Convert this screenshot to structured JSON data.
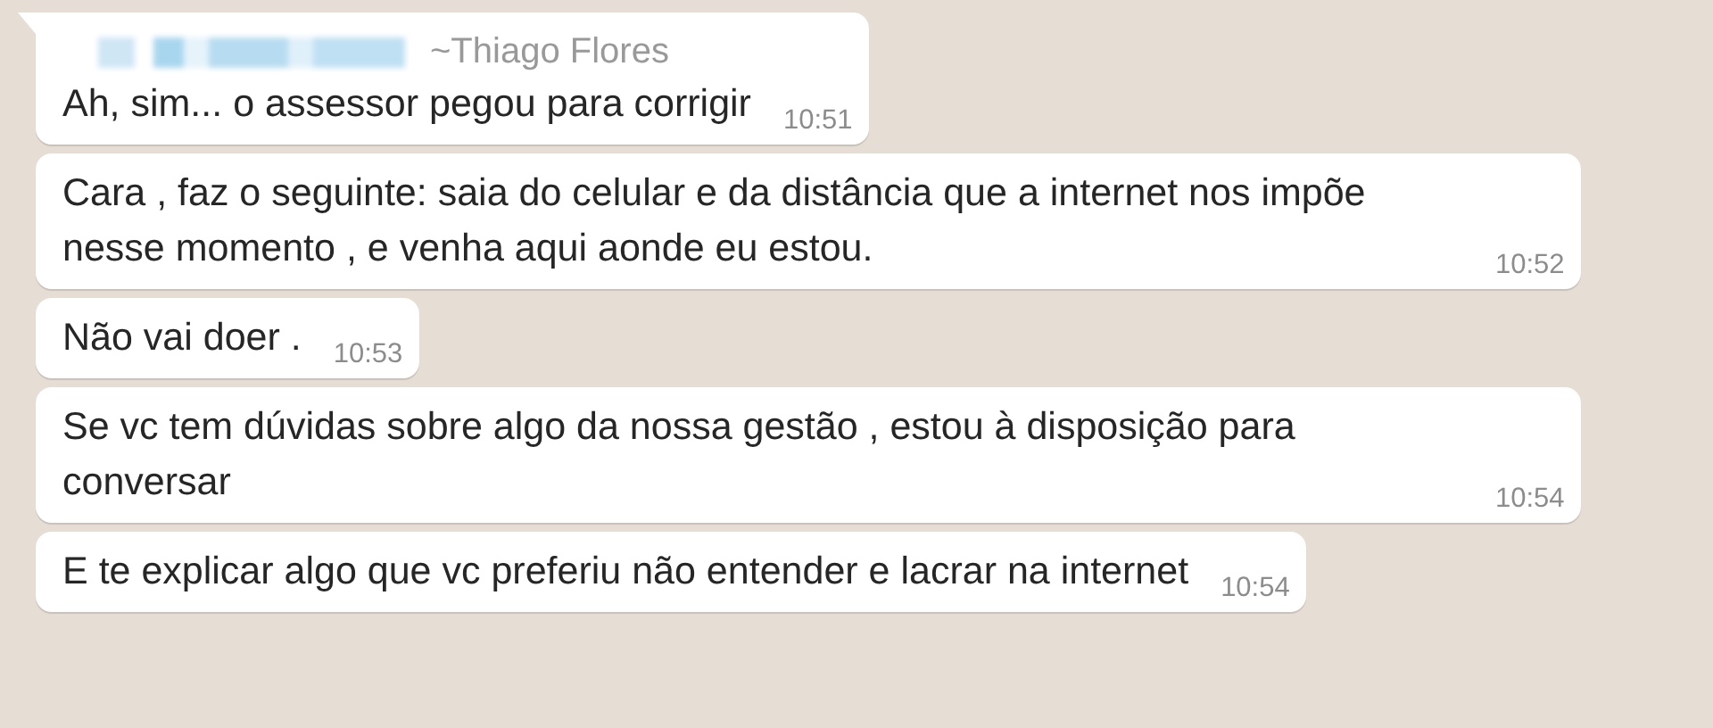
{
  "messages": [
    {
      "sender": {
        "number_redacted": true,
        "name": "~Thiago Flores"
      },
      "tail": true,
      "text": "Ah, sim... o assessor pegou para corrigir",
      "time": "10:51"
    },
    {
      "tail": false,
      "text": "Cara , faz o seguinte: saia do celular e da distância que a internet nos impõe nesse momento , e venha aqui aonde eu estou.",
      "time": "10:52"
    },
    {
      "tail": false,
      "text": "Não vai doer .",
      "time": "10:53"
    },
    {
      "tail": false,
      "text": "Se vc tem dúvidas sobre algo da nossa gestão , estou à disposição para conversar",
      "time": "10:54"
    },
    {
      "tail": false,
      "text": "E te explicar algo que vc preferiu não entender e lacrar na internet",
      "time": "10:54"
    }
  ]
}
